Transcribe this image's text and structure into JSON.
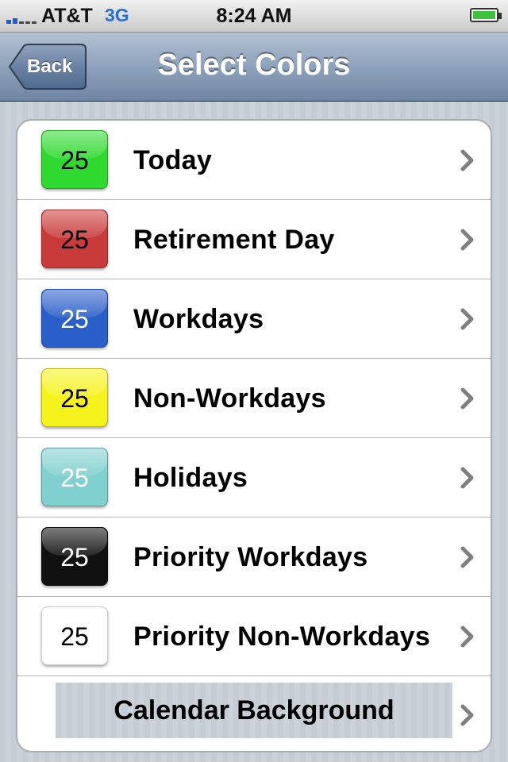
{
  "status_bar": {
    "carrier": "AT&T",
    "network": "3G",
    "time": "8:24 AM"
  },
  "nav": {
    "back_label": "Back",
    "title": "Select Colors"
  },
  "color_rows": [
    {
      "swatch_text": "25",
      "label": "Today",
      "swatch_color": "#2fd92f",
      "text_color": "#000000"
    },
    {
      "swatch_text": "25",
      "label": "Retirement Day",
      "swatch_color": "#c93a3a",
      "text_color": "#000000"
    },
    {
      "swatch_text": "25",
      "label": "Workdays",
      "swatch_color": "#2a5ec9",
      "text_color": "#ffffff"
    },
    {
      "swatch_text": "25",
      "label": "Non-Workdays",
      "swatch_color": "#f6f21c",
      "text_color": "#000000"
    },
    {
      "swatch_text": "25",
      "label": "Holidays",
      "swatch_color": "#7fd0cf",
      "text_color": "#ffffff"
    },
    {
      "swatch_text": "25",
      "label": "Priority Workdays",
      "swatch_color": "#111111",
      "text_color": "#ffffff"
    },
    {
      "swatch_text": "25",
      "label": "Priority Non-Workdays",
      "swatch_color": "#ffffff",
      "text_color": "#000000"
    }
  ],
  "calendar_background": {
    "label": "Calendar Background"
  },
  "icons": {
    "row_accessory": "chevron-right-icon",
    "battery": "battery-charging-icon",
    "signal": "signal-strength-icon"
  }
}
